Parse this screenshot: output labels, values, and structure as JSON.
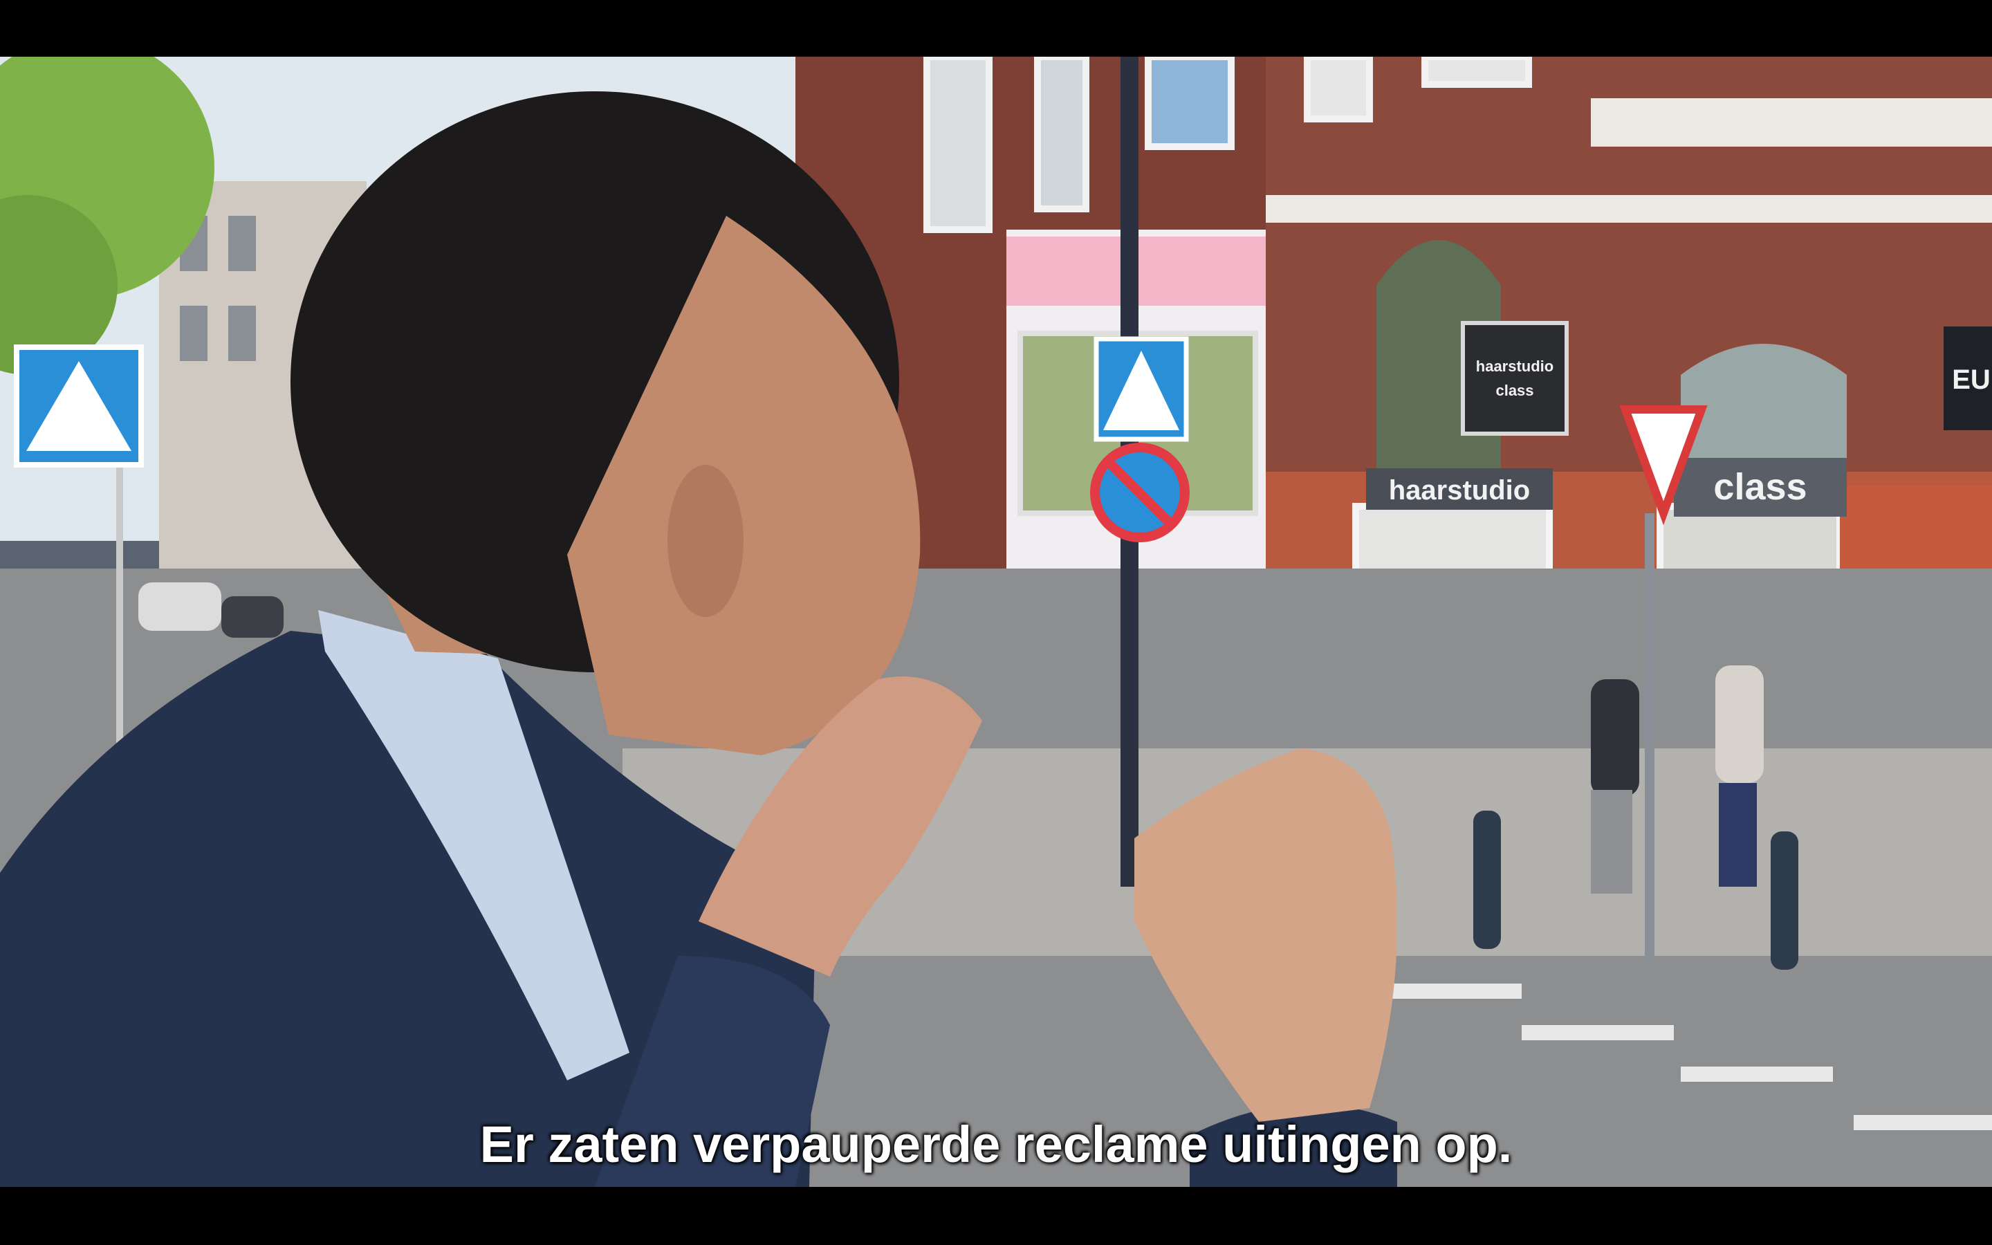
{
  "video": {
    "subtitle": "Er zaten verpauperde reclame uitingen op.",
    "signs": {
      "shop_main": "haarstudio",
      "shop_secondary": "class",
      "hanging_line1": "haarstudio",
      "hanging_line2": "class",
      "corner_partial": "EU"
    }
  },
  "colors": {
    "letterbox": "#000000",
    "subtitle": "#ffffff",
    "crosswalk_sign": "#2a8fd6",
    "brick": "#8b4a3c",
    "jacket": "#25324d"
  }
}
